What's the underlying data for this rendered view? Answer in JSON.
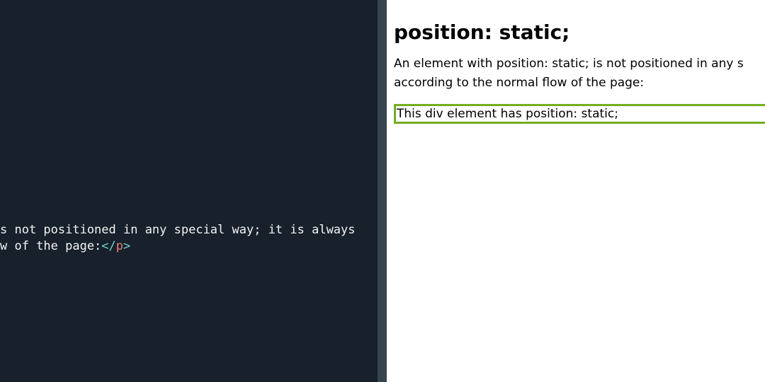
{
  "editor": {
    "line1": "s not positioned in any special way; it is always",
    "line2_text": "w of the page:",
    "line2_close_open": "</",
    "line2_close_tag": "p",
    "line2_close_end": ">"
  },
  "preview": {
    "heading": "position: static;",
    "paragraph_line1": "An element with position: static; is not positioned in any s",
    "paragraph_line2": "according to the normal flow of the page:",
    "box_text": "This div element has position: static;"
  },
  "colors": {
    "editor_background": "#17202b",
    "divider": "#38444d",
    "code_text": "#f4f4f4",
    "code_tag": "#ec7f78",
    "code_bracket": "#6fd3cc",
    "box_border": "#73ad21"
  }
}
